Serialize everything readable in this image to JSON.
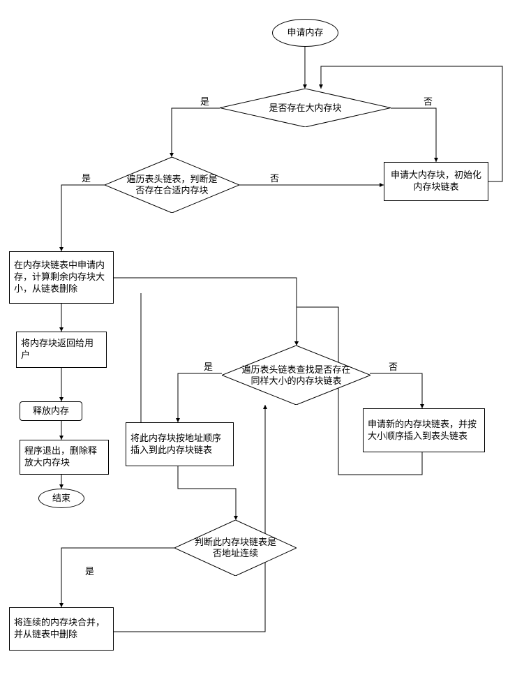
{
  "nodes": {
    "start": "申请内存",
    "d1": "是否存在大内存块",
    "d2": "遍历表头链表，判断是否存在合适内存块",
    "p1": "申请大内存块，初始化内存块链表",
    "p2": "在内存块链表中申请内存，计算剩余内存块大小，从链表删除",
    "p3": "将内存块返回给用户",
    "p4": "释放内存",
    "p5": "程序退出，删除释放大内存块",
    "end": "结束",
    "d3": "遍历表头链表查找是否存在同样大小的内存块链表",
    "p6": "将此内存块按地址顺序插入到此内存块链表",
    "p7": "申请新的内存块链表，并按大小顺序插入到表头链表",
    "d4": "判断此内存块链表是否地址连续",
    "p8": "将连续的内存块合并，并从链表中删除"
  },
  "labels": {
    "yes": "是",
    "no": "否"
  }
}
